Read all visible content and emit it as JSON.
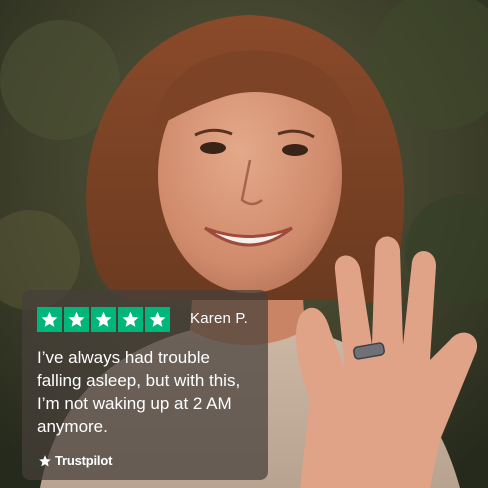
{
  "review": {
    "rating_stars": 5,
    "reviewer_name": "Karen P.",
    "quote": "I’ve always had trouble falling asleep, but with this, I’m not waking up at 2 AM anymore.",
    "brand": "Trustpilot"
  },
  "colors": {
    "star_background": "#00b67a",
    "card_background": "#46403a",
    "text": "#ffffff"
  },
  "icons": [
    "star-icon",
    "trustpilot-star-icon"
  ]
}
